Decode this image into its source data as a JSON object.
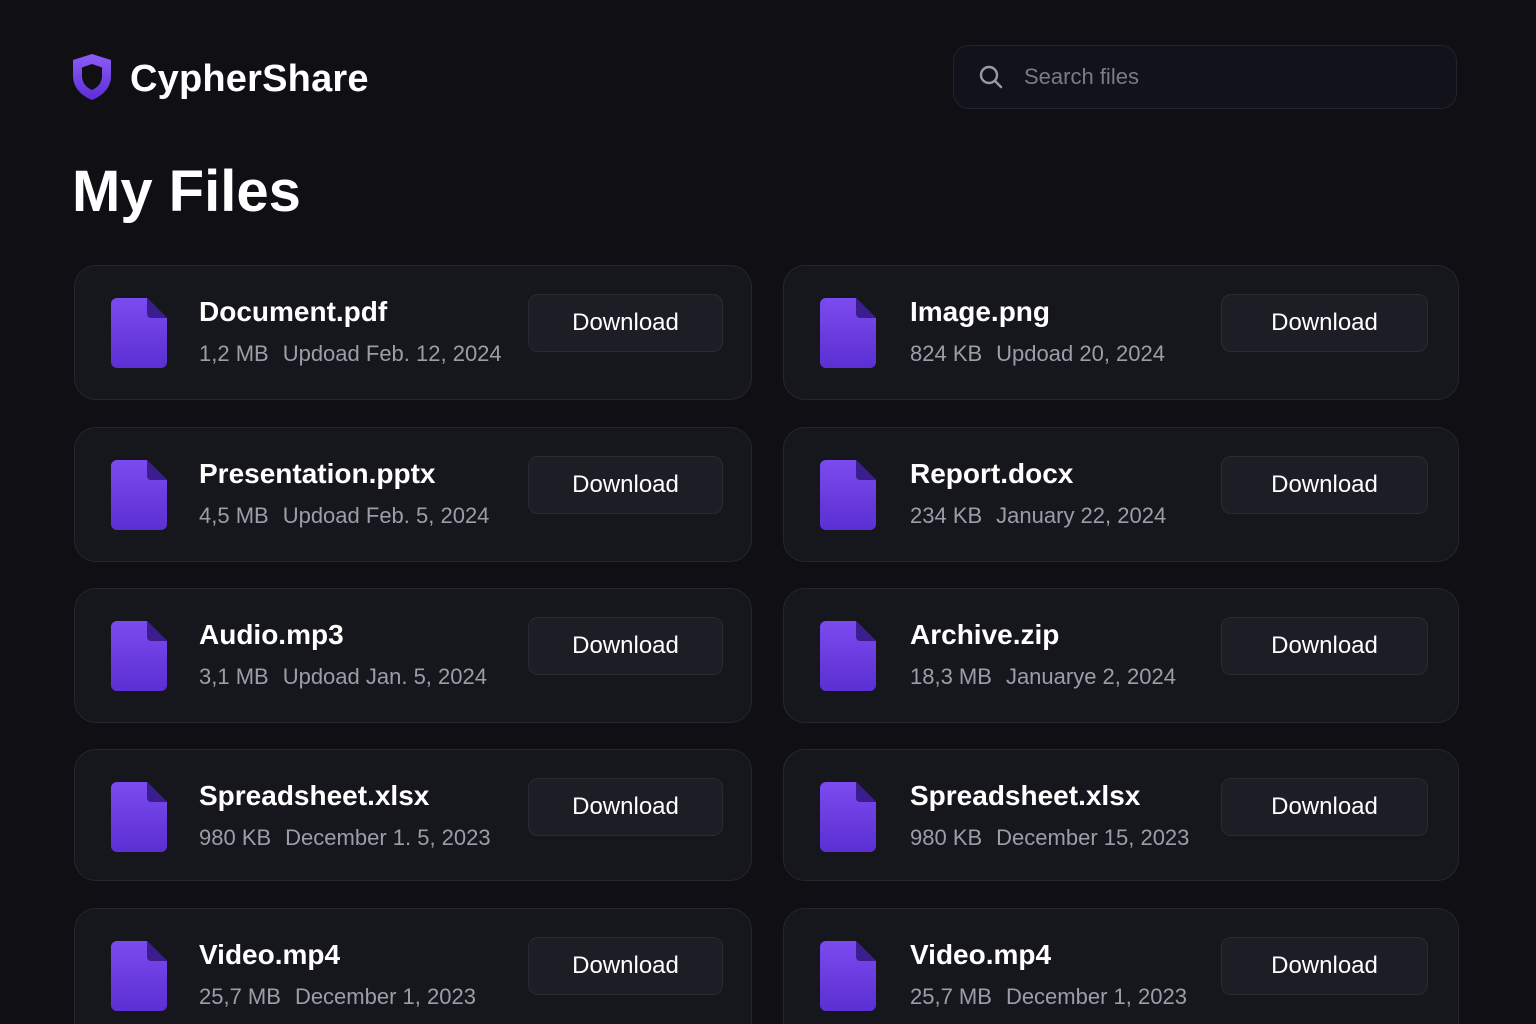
{
  "app": {
    "name": "CypherShare",
    "accent_color": "#6d3fe0",
    "logo_icon": "shield-icon"
  },
  "search": {
    "placeholder": "Search files",
    "icon": "search-icon"
  },
  "page": {
    "title": "My Files"
  },
  "files": [
    {
      "name": "Document.pdf",
      "size": "1,2 MB",
      "date": "Updoad  Feb. 12, 2024",
      "action": "Download",
      "icon": "file-icon"
    },
    {
      "name": "Image.png",
      "size": "824 KB",
      "date": "Updoad 20, 2024",
      "action": "Download",
      "icon": "file-icon"
    },
    {
      "name": "Presentation.pptx",
      "size": "4,5 MB",
      "date": "Updoad  Feb. 5, 2024",
      "action": "Download",
      "icon": "file-icon"
    },
    {
      "name": "Report.docx",
      "size": "234 KB",
      "date": "January 22, 2024",
      "action": "Download",
      "icon": "file-icon"
    },
    {
      "name": "Audio.mp3",
      "size": "3,1 MB",
      "date": "Updoad  Jan. 5, 2024",
      "action": "Download",
      "icon": "file-icon"
    },
    {
      "name": "Archive.zip",
      "size": "18,3 MB",
      "date": "Januarye  2, 2024",
      "action": "Download",
      "icon": "file-icon"
    },
    {
      "name": "Spreadsheet.xlsx",
      "size": "980 KB",
      "date": "December  1. 5, 2023",
      "action": "Download",
      "icon": "file-icon"
    },
    {
      "name": "Spreadsheet.xlsx",
      "size": "980 KB",
      "date": "December 15, 2023",
      "action": "Download",
      "icon": "file-icon"
    },
    {
      "name": "Video.mp4",
      "size": "25,7 MB",
      "date": "December   1, 2023",
      "action": "Download",
      "icon": "file-icon"
    },
    {
      "name": "Video.mp4",
      "size": "25,7 MB",
      "date": "December 1, 2023",
      "action": "Download",
      "icon": "file-icon"
    }
  ]
}
